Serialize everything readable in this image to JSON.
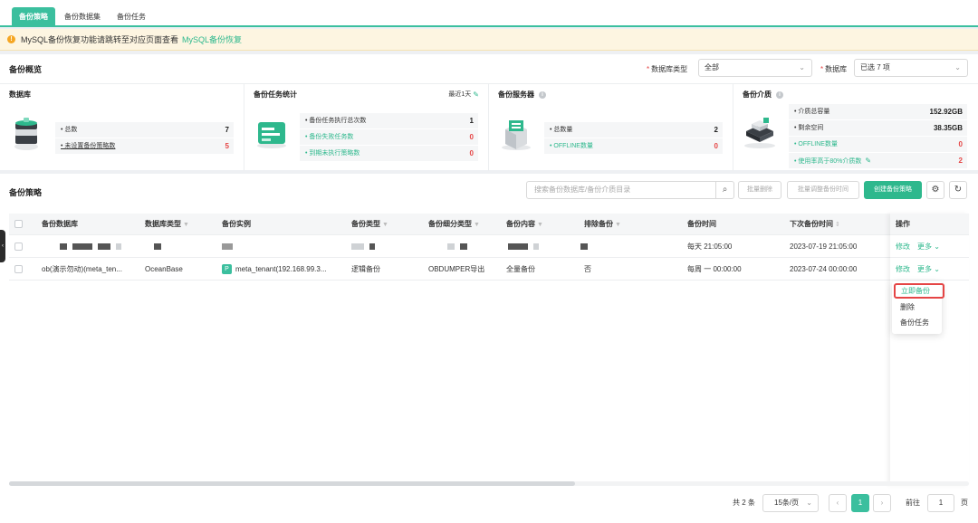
{
  "tabs": [
    {
      "label": "备份策略",
      "active": true
    },
    {
      "label": "备份数据集"
    },
    {
      "label": "备份任务"
    }
  ],
  "alert": {
    "text": "MySQL备份恢复功能请跳转至对应页面查看",
    "link": "MySQL备份恢复"
  },
  "overview": {
    "title": "备份概览",
    "filters": {
      "db_type_label": "数据库类型",
      "db_type_value": "全部",
      "db_label": "数据库",
      "db_value": "已选 7 项"
    },
    "cards": {
      "database": {
        "title": "数据库",
        "rows": [
          {
            "label": "• 总数",
            "value": "7"
          },
          {
            "label": "• 未设置备份策略数",
            "value": "5"
          }
        ]
      },
      "task_stats": {
        "title": "备份任务统计",
        "extra": "最近1天",
        "rows": [
          {
            "label": "• 备份任务执行总次数",
            "value": "1"
          },
          {
            "label": "• 备份失败任务数",
            "value": "0"
          },
          {
            "label": "• 到期未执行策略数",
            "value": "0"
          }
        ]
      },
      "server": {
        "title": "备份服务器",
        "rows": [
          {
            "label": "• 总数量",
            "value": "2"
          },
          {
            "label": "• OFFLINE数量",
            "value": "0"
          }
        ]
      },
      "media": {
        "title": "备份介质",
        "rows": [
          {
            "label": "• 介质总容量",
            "value": "152.92GB"
          },
          {
            "label": "• 剩余空间",
            "value": "38.35GB"
          },
          {
            "label": "• OFFLINE数量",
            "value": "0"
          },
          {
            "label": "• 使用率高于80%介质数",
            "value": "2"
          }
        ]
      }
    }
  },
  "strategy": {
    "title": "备份策略",
    "search_placeholder": "搜索备份数据库/备份介质目录",
    "buttons": {
      "batch_delete": "批量删除",
      "batch_adjust": "批量调整备份时间",
      "create": "创建备份策略"
    },
    "columns": [
      "备份数据库",
      "数据库类型",
      "备份实例",
      "备份类型",
      "备份细分类型",
      "备份内容",
      "排除备份",
      "备份时间",
      "下次备份时间",
      "操作"
    ],
    "rows": [
      {
        "schedule": "每天 21:05:00",
        "next": "2023-07-19 21:05:00",
        "edit": "修改",
        "more": "更多"
      },
      {
        "db": "ob(演示勿动)(meta_ten...",
        "db_type": "OceanBase",
        "instance_tag": "P",
        "instance": "meta_tenant(192.168.99.3...",
        "type": "逻辑备份",
        "subtype": "OBDUMPER导出",
        "content": "全量备份",
        "exclude": "否",
        "schedule": "每周 一 00:00:00",
        "next": "2023-07-24 00:00:00",
        "edit": "修改",
        "more": "更多"
      }
    ],
    "dropdown": [
      "立即备份",
      "删除",
      "备份任务"
    ]
  },
  "pager": {
    "total": "共 2 条",
    "page_size": "15条/页",
    "current": "1",
    "goto_label": "前往",
    "goto_value": "1",
    "page_unit": "页"
  }
}
